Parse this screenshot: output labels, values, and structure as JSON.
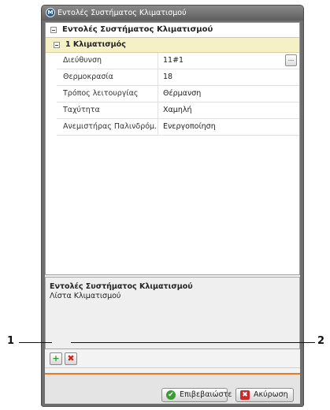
{
  "window": {
    "title": "Εντολές Συστήματος Κλιματισμού",
    "icon": "app-logo-icon"
  },
  "property_grid": {
    "header": "Εντολές Συστήματος Κλιματισμού",
    "category": "1 Κλιματισμός",
    "properties": [
      {
        "name": "Διεύθυνση",
        "value": "11#1",
        "has_browse": true
      },
      {
        "name": "Θερμοκρασία",
        "value": "18"
      },
      {
        "name": "Τρόπος λειτουργίας",
        "value": "Θέρμανση"
      },
      {
        "name": "Ταχύτητα",
        "value": "Χαμηλή"
      },
      {
        "name": "Ανεμιστήρας Παλινδρόμ...",
        "value": "Ενεργοποίηση"
      }
    ],
    "browse_label": "..."
  },
  "description": {
    "title": "Εντολές Συστήματος Κλιματισμού",
    "text": "Λίστα Κλιματισμού"
  },
  "toolbar": {
    "add_icon": "add-icon",
    "remove_icon": "remove-icon",
    "add_glyph": "+",
    "remove_glyph": "✖"
  },
  "buttons": {
    "confirm_label": "Επιβεβαιώστε",
    "cancel_label": "Ακύρωση",
    "confirm_glyph": "✔",
    "cancel_glyph": "✖"
  },
  "callouts": {
    "left": "1",
    "right": "2"
  },
  "colors": {
    "accent_line": "#ee7a1f",
    "category_background": "#f5f0c6"
  }
}
